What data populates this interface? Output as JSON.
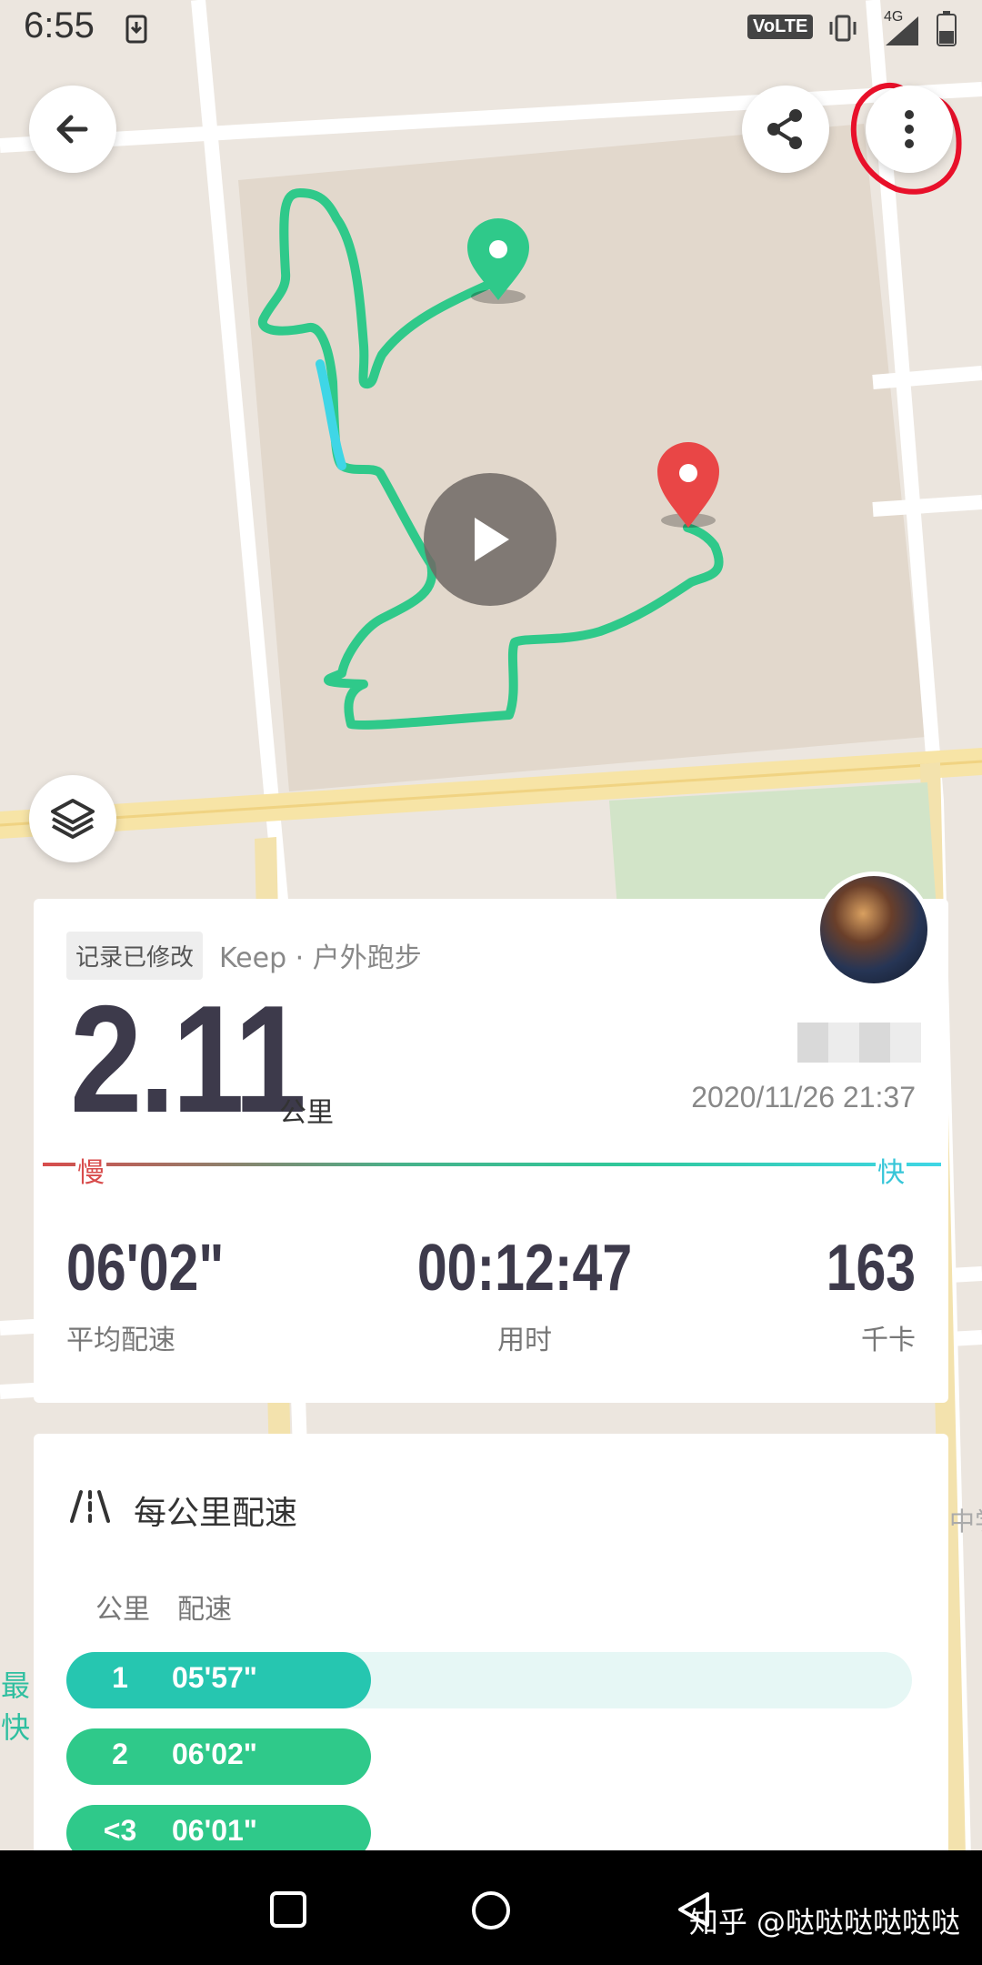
{
  "status_bar": {
    "time": "6:55",
    "network": "4G",
    "volte": "VoLTE"
  },
  "summary": {
    "modified_chip": "记录已修改",
    "source": "Keep · 户外跑步",
    "distance": "2.11",
    "distance_unit": "公里",
    "datetime": "2020/11/26 21:37",
    "slow_label": "慢",
    "fast_label": "快",
    "stats": [
      {
        "value": "06'02\"",
        "label": "平均配速"
      },
      {
        "value": "00:12:47",
        "label": "用时"
      },
      {
        "value": "163",
        "label": "千卡"
      }
    ]
  },
  "splits": {
    "title": "每公里配速",
    "col_km": "公里",
    "col_pace": "配速",
    "rows": [
      {
        "km": "1",
        "pace": "05'57\"",
        "tag": "最快",
        "fill_fraction": 0.36,
        "color": "#26c6b0"
      },
      {
        "km": "2",
        "pace": "06'02\"",
        "tag": "",
        "fill_fraction": 0.36,
        "color": "#2fc98a"
      },
      {
        "km": "<3",
        "pace": "06'01\"",
        "tag": "",
        "fill_fraction": 0.36,
        "color": "#2fc98a"
      }
    ]
  },
  "watermark": "知乎 @哒哒哒哒哒哒",
  "colors": {
    "route_green": "#2fc98a",
    "route_cyan": "#3fd6e6",
    "start_pin": "#2fc98a",
    "end_pin": "#e94646",
    "annotation_red": "#e8102a"
  }
}
